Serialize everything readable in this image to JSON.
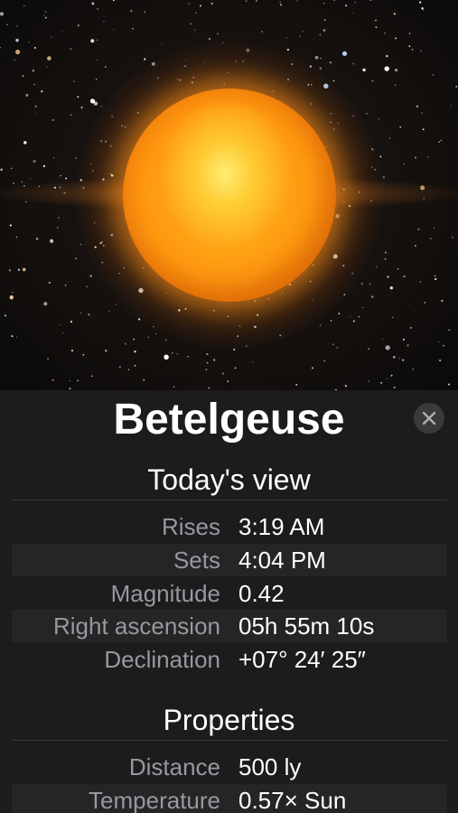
{
  "star_name": "Betelgeuse",
  "close_icon": "close-icon",
  "colors": {
    "sheet_background": "#1c1c1e",
    "label_color": "#98989d",
    "value_color": "#ffffff",
    "star_color": "#ff9a10"
  },
  "todays_view": {
    "heading": "Today's view",
    "rows": [
      {
        "label": "Rises",
        "value": "3:19 AM"
      },
      {
        "label": "Sets",
        "value": "4:04 PM"
      },
      {
        "label": "Magnitude",
        "value": "0.42"
      },
      {
        "label": "Right ascension",
        "value": "05h 55m 10s"
      },
      {
        "label": "Declination",
        "value": "+07° 24′ 25″"
      }
    ]
  },
  "properties": {
    "heading": "Properties",
    "rows": [
      {
        "label": "Distance",
        "value": "500 ly"
      },
      {
        "label": "Temperature",
        "value": "0.57× Sun"
      }
    ]
  }
}
